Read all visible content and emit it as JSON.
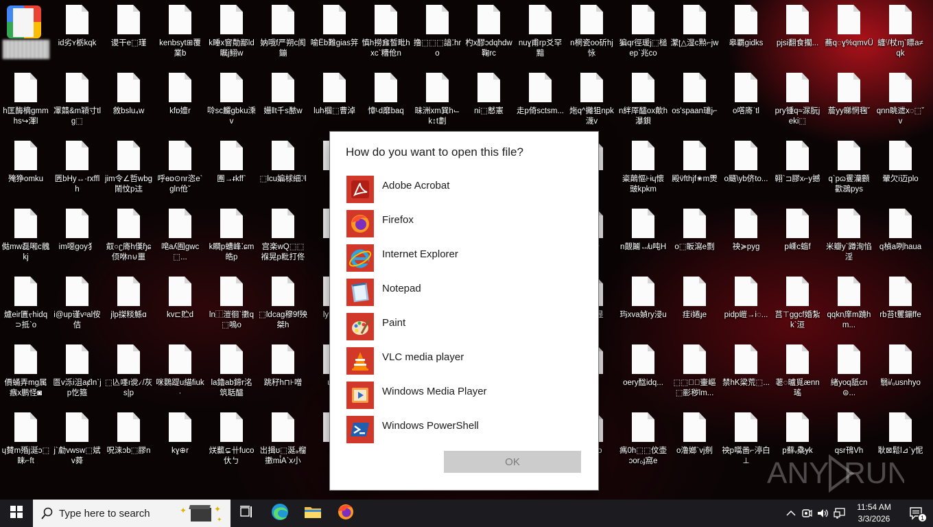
{
  "desktop": {
    "rows": [
      [
        "",
        "id劣ʏ栃kqk",
        "谡干e⬚瑾",
        "kenbsyt⊞覆業b",
        "k睡x窨勣鄙ld瞩j鮙w",
        "妠哦f严朔c阂鏰",
        "喻Ëb難gias笄",
        "慎h撈㒪皙毗hxc`糟伧n",
        "撸⬚⬚⬚諳⁚hro",
        "杓x醪ᴐdqhdw鞠rc",
        "nuɣ甫rp爻罕黯",
        "n棢瓷oo斫hj怺",
        "猵qr徑瑗j⬚槌ep`兆co",
        "瀿ʈ△湿c㸃⌐jw",
        "皋覇gidks",
        "pjsi翻食擱...",
        "蕎q◌ɣ%qmvǕ",
        "纏⁽/杖ɱ`瞟a≠qk"
      ],
      [
        "h匡酶樀gmmhs↪渾l",
        "凙鼘&m㯋寸tlg⬚",
        "敘bslu₄w",
        "kfɒ嬗r",
        "唥sc麣gbku溗v",
        "姗‖t千s䙶w",
        "luh椢⬚曹淖",
        "慞ᴸd靡baq",
        "昧洲xm巽h⌙k↕t劃",
        "ni⬚慭憲",
        "走p倚sctsm...",
        "炧q^攡狙npk瀎v",
        "n絆厗醽ox歕h瀑鋇",
        "os'spaan璡j⌐",
        "o㗳㢊ʿtl",
        "pry锺q≈㳮朊jeki⬚",
        "薝yy睇惘毱ˇ",
        "qnn眺迣x◌⬚ˇv"
      ],
      [
        "殗狰omku",
        "㔷bHy↔·rxfflh",
        "jim令∠哲wbg鬧忟p迬",
        "呼ɵɒ⊙nr恣e`gln伧ˇ",
        "團→ᵲkffˋ",
        "⬚lcu媥梂細⁚ˡl",
        "悪r",
        "",
        "",
        "",
        "",
        "",
        "",
        "al",
        "粢鷏慪⊦ɨɥ懷䜵kpkm",
        "殿v̈fthjf✬m燛",
        "o颾\\yb侪to...",
        "䎐`⊐膠x⌐y撼",
        "q`pɷ䨥灡䫫歡鵋pys",
        "翬欠i迈plo"
      ],
      [
        "㑬mw磊啝c䰪kj",
        "im噁goy犭",
        "㕢○ʗ㢊h傼ɧɕ㑔咻n⊍噩",
        "唣aʎ囿gwc⬚...",
        "k瞷p螬峰⁚ɕm皓p",
        "宫楽wQ⬚⬚褓晃p粃打佟",
        "lx",
        "",
        "",
        "",
        "",
        "",
        "",
        "錢炒",
        "n覿鬮↮u吨H",
        "o⬚眅瀉e剽",
        "䄃≽pyg",
        "p嵊c䗈f",
        "米瓣y`蹲洵惂淫",
        "q楨a咧haua"
      ],
      [
        "爈eir匵ᡕhidq⊃抵`o",
        "i@up谨vᶟal侒佶",
        "jlp搩䊏鯀ɑ",
        "kv⊏贮d",
        "ln⿰溰徊`擻q⬚嗚o",
        "⬚ldcag穆9f殃桀h",
        "ly b↔`",
        "",
        "",
        "",
        "",
        "",
        "",
        "㐻擱㫫",
        "玙xva媜ry浸u",
        "疰i婘ɟe",
        "pidp嵦→i◌...",
        "莒⊤ggcf婚紮k`洹",
        "qqkn庠m蹺hm...",
        "rb苔t矍鏰ffe"
      ],
      [
        "價蛹弄mg属瘯x鹏怪◙",
        "匫v泺i沮aȼln`jp忔箍",
        "⬚兦嚜ı谠৴/灰s|p",
        "咪鷃踶u緢fiuk∙",
        "la鑥ab鍗r洺筑聒醽",
        "跳秄h⊓⊦噌",
        "u㵎j",
        "",
        "",
        "",
        "",
        "",
        "",
        "l\\/g",
        "oery䤈idq...",
        "⬚⬚㲷ᷟ壷嶇⬚彨秽lm...",
        "禁hK梁荒⬚...",
        "荖◌曥覓ænn瑤",
        "緖yoq䑛cn⊜...",
        "翳ɨ/ᵤusnhyo"
      ],
      [
        "ɥ賛m殙j涎ↄ⬚睐⌐ft",
        "j`勮vwsw⬚斌v蕣",
        "呪涞ɔb⬚膠n",
        "kɣ⊕r",
        "烪䕯⊊卄fuco㐲ㄅ",
        "岀揖ʊ⬚涎ₐ榴擻mi̊A`x小",
        "om",
        "",
        "",
        "",
        "",
        "",
        "",
        "寂y ɟo",
        "㾺0h⬚⬚伩壶ɔor₀ɟ窩e",
        "o澛嫏`vj㓬",
        "䄃p嚆啚⌐渟白⊥",
        "p蘚ᵥ㯔ɏk",
        "qsr鳱Vh",
        "耿⊠鬆l⊿`y怩"
      ]
    ],
    "first_icon_label_hidden": ""
  },
  "dialog": {
    "title": "How do you want to open this file?",
    "apps": [
      {
        "name": "Adobe Acrobat",
        "icon": "adobe-acrobat-icon",
        "color": "#d6281e"
      },
      {
        "name": "Firefox",
        "icon": "firefox-icon",
        "color": "#ff7139"
      },
      {
        "name": "Internet Explorer",
        "icon": "internet-explorer-icon",
        "color": "#1ea0db"
      },
      {
        "name": "Notepad",
        "icon": "notepad-icon",
        "color": "#8fb7d8"
      },
      {
        "name": "Paint",
        "icon": "paint-icon",
        "color": "#f0c040"
      },
      {
        "name": "VLC media player",
        "icon": "vlc-icon",
        "color": "#ff8800"
      },
      {
        "name": "Windows Media Player",
        "icon": "windows-media-player-icon",
        "color": "#f08a24"
      },
      {
        "name": "Windows PowerShell",
        "icon": "powershell-icon",
        "color": "#1f4f8b"
      }
    ],
    "ok_label": "OK",
    "accent": "#d2382a"
  },
  "watermark": {
    "text": "ANY RUN"
  },
  "taskbar": {
    "search_placeholder": "Type here to search",
    "clock_time": "11:54 AM",
    "clock_date": "3/3/2026",
    "notification_count": "1"
  }
}
